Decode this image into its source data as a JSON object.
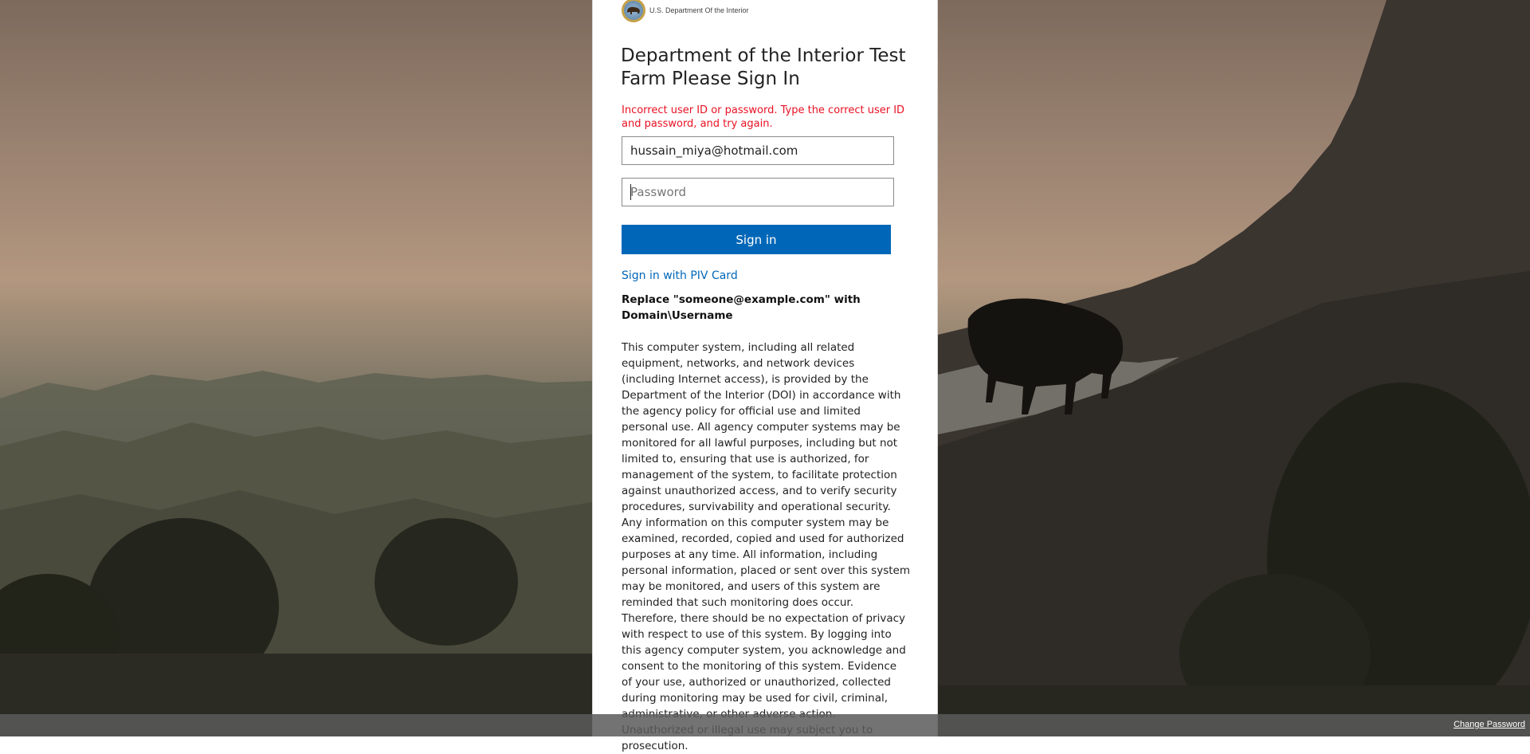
{
  "logo": {
    "icon": "doi-seal-icon",
    "text": "U.S. Department Of the Interior"
  },
  "title": "Department of the Interior Test Farm Please Sign In",
  "error_message": "Incorrect user ID or password. Type the correct user ID and password, and try again.",
  "username": {
    "value": "hussain_miya@hotmail.com"
  },
  "password": {
    "placeholder": "Password",
    "value": ""
  },
  "signin_label": "Sign in",
  "piv_link": "Sign in with PIV Card",
  "hint": "Replace \"someone@example.com\" with Domain\\Username",
  "disclaimer": "This computer system, including all related equipment, networks, and network devices (including Internet access), is provided by the Department of the Interior (DOI) in accordance with the agency policy for official use and limited personal use. All agency computer systems may be monitored for all lawful purposes, including but not limited to, ensuring that use is authorized, for management of the system, to facilitate protection against unauthorized access, and to verify security procedures, survivability and operational security. Any information on this computer system may be examined, recorded, copied and used for authorized purposes at any time. All information, including personal information, placed or sent over this system may be monitored, and users of this system are reminded that such monitoring does occur. Therefore, there should be no expectation of privacy with respect to use of this system. By logging into this agency computer system, you acknowledge and consent to the monitoring of this system. Evidence of your use, authorized or unauthorized, collected during monitoring may be used for civil, criminal, administrative, or other adverse action. Unauthorized or illegal use may subject you to prosecution.",
  "footer": {
    "change_password": "Change Password"
  },
  "colors": {
    "accent": "#0067b8",
    "error": "#e81123"
  }
}
